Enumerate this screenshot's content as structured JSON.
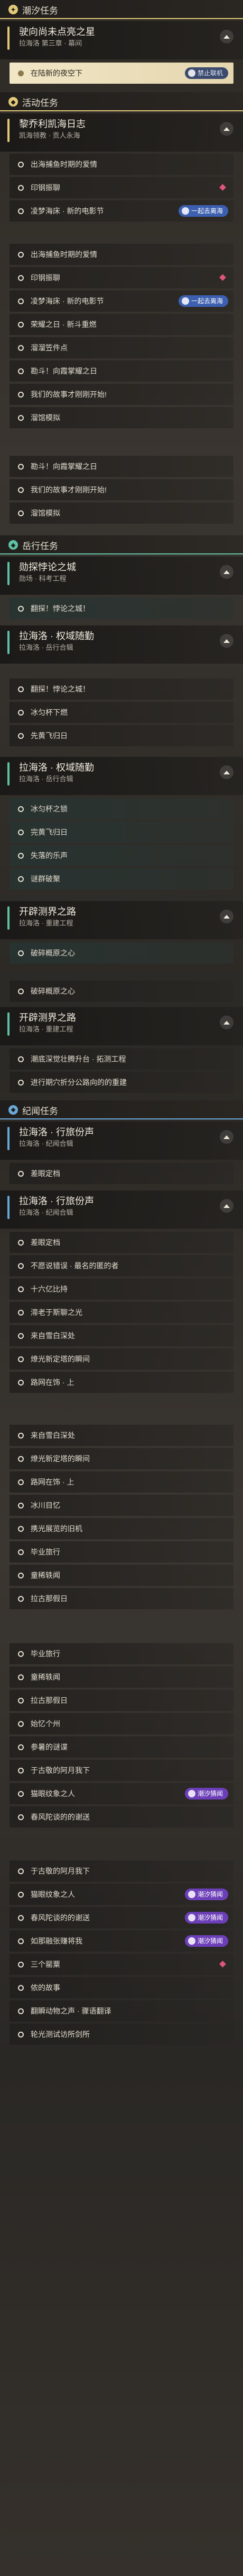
{
  "colors": {
    "accent_gold": "#e2c97a",
    "accent_teal": "#5fc2a4",
    "accent_blue": "#6aa8d8",
    "badge_blue": "#3c5fb0",
    "badge_purple": "#6c3fb8",
    "alert_pink": "#e0567a"
  },
  "sections": {
    "tide": {
      "title": "潮汐任务",
      "icon": "tide-icon"
    },
    "event": {
      "title": "活动任务",
      "icon": "event-icon"
    },
    "side": {
      "title": "岳行任务",
      "icon": "side-icon"
    },
    "record": {
      "title": "纪闻任务",
      "icon": "record-icon"
    }
  },
  "quests": {
    "q1": {
      "name": "驶向尚未点亮之星",
      "sub": "拉海洛 第三章 · 幕间",
      "step": "在陆新的夜空下",
      "badge": "禁止联机"
    },
    "q2": {
      "name": "黎乔利凯海日志",
      "sub": "凯海领教 · 贡人永海"
    },
    "q3": {
      "name": "勋探悖论之城",
      "sub": "勋场 · 科考工程"
    },
    "q4": {
      "name": "拉海洛 · 权域随勤",
      "sub": "拉海洛 · 岳行合辑"
    },
    "q5": {
      "name": "拉海洛 · 权域随勤",
      "sub": "拉海洛 · 岳行合辑"
    },
    "q6": {
      "name": "开辟测界之路",
      "sub": "拉海洛 · 重建工程"
    },
    "q7": {
      "name": "开辟测界之路",
      "sub": "拉海洛 · 重建工程"
    },
    "q8": {
      "name": "拉海洛 · 行旅份声",
      "sub": "拉海洛 · 纪闻合辑"
    },
    "q9": {
      "name": "拉海洛 · 行旅份声",
      "sub": "拉海洛 · 纪闻合辑"
    }
  },
  "steps": {
    "s1": "出海捕鱼时期的爱情",
    "s2": "印钢振聊",
    "s3": "凌梦海床 · 新的电影节",
    "s4": "出海捕鱼时期的爱情",
    "s5": "印钢振聊",
    "s6": "凌梦海床 · 新的电影节",
    "s7": "荣耀之日 · 新斗重燃",
    "s8": "溜溜笠件点",
    "s9": "勘斗！向霞掌耀之日",
    "s10": "我们的故事才刚刚开始!",
    "s11": "溜馆模拟",
    "s12": "勘斗！向霞掌耀之日",
    "s13": "我们的故事才刚刚开始!",
    "s14": "溜馆模拟",
    "s15": "翻探！悖论之城！",
    "s16": "翻探！悖论之城！",
    "s17": "冰匀杯下燃",
    "s18": "先黄飞归日",
    "s19": "冰匀杯之锁",
    "s20": "完黄飞归日",
    "s21": "失落的乐声",
    "s22": "谜群破聚",
    "s23": "破碎概原之心",
    "s24": "破碎概原之心",
    "s25": "潮底深觉壮腾升台 · 拓测工程",
    "s26": "进行期穴折分公路向的的重建",
    "s27": "差眼定档",
    "s28": "差眼定档",
    "s29": "不愿说错误 · 最名的匿的者",
    "s30": "十六亿比持",
    "s31": "滞老于斯聊之光",
    "s32": "来自雪白深处",
    "s33": "燎光新定塔的瞬间",
    "s34": "路网在饰 · 上",
    "s35": "来自雪白深处",
    "s36": "燎光新定塔的瞬间",
    "s37": "路网在饰 · 上",
    "s38": "冰川目忆",
    "s39": "携光展览的旧机",
    "s40": "毕业旅行",
    "s41": "童稀轶闻",
    "s42": "拉古那假日",
    "s43": "毕业旅行",
    "s44": "童稀轶闻",
    "s45": "拉古那假日",
    "s46": "始忆个州",
    "s47": "参暑的谜谍",
    "s48": "于古敬的阿月我下",
    "s49": "猫眼纹象之人",
    "s50": "春风陀谈的的谢送",
    "s51": "于古敬的阿月我下",
    "s52": "猫眼纹象之人",
    "s53": "春风陀谈的的谢送",
    "s54": "如那融张赚将我",
    "s55": "三个罂粟",
    "s56": "侬的故事",
    "s57": "翻瞬动物之声 · 骤语翻译",
    "s58": "轮光测试访所剑所"
  },
  "badges": {
    "b1": "一起去离海",
    "b2": "一起去离海",
    "b3": "潮汐猜闻",
    "b4": "潮汐猜闻",
    "b5": "潮汐猜闻",
    "b6": "潮汐猜闻"
  }
}
